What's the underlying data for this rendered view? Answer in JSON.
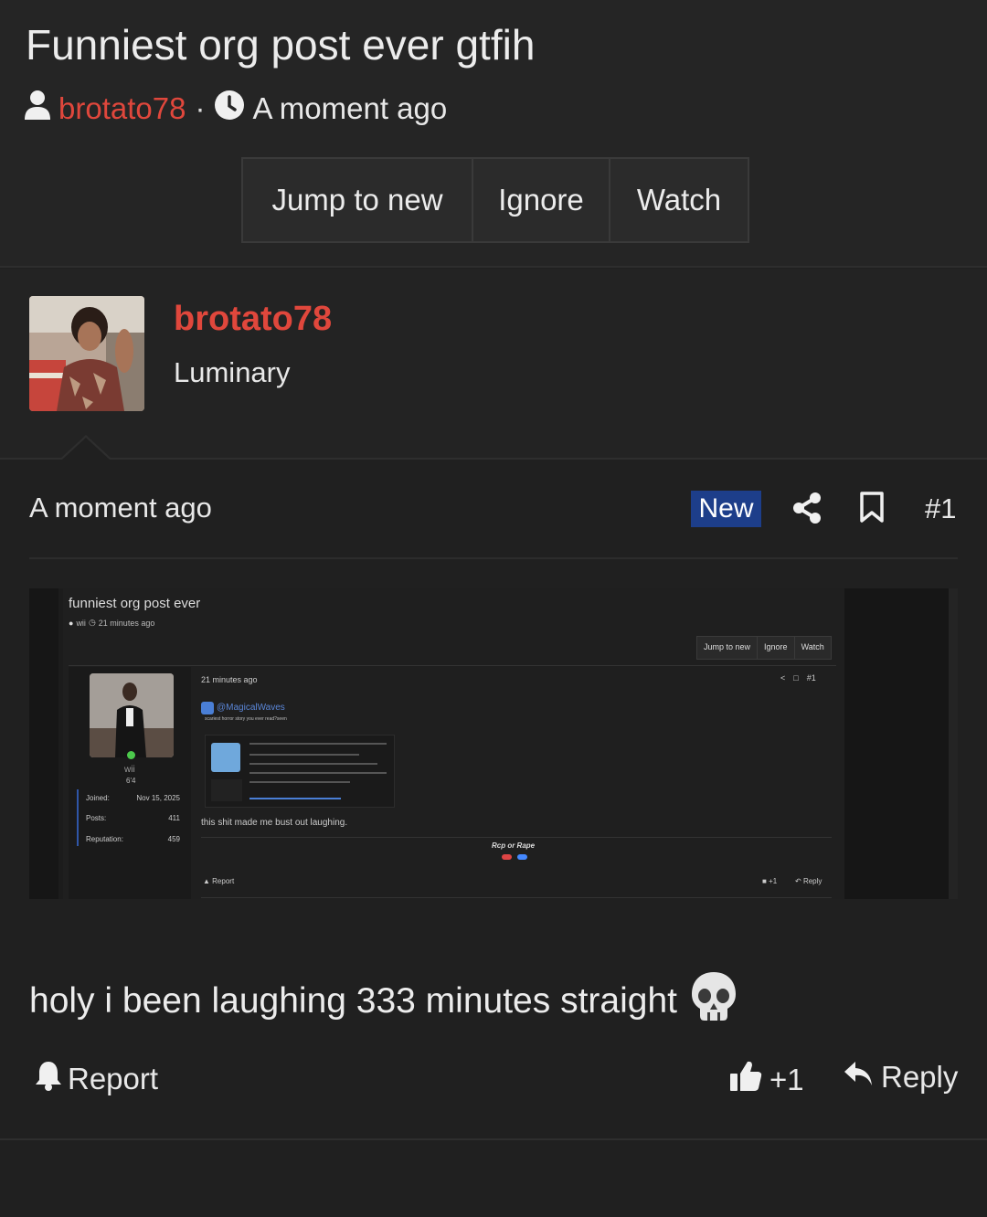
{
  "thread": {
    "title": "Funniest org post ever gtfih",
    "author": "brotato78",
    "separator": "·",
    "time": "A moment ago",
    "actions": {
      "jump": "Jump to new",
      "ignore": "Ignore",
      "watch": "Watch"
    }
  },
  "post": {
    "username": "brotato78",
    "rank": "Luminary",
    "time": "A moment ago",
    "badge": "New",
    "number": "#1",
    "body": "holy i been laughing 333 minutes straight",
    "emoji": "skull-icon",
    "report_label": "Report",
    "like_label": "+1",
    "reply_label": "Reply"
  },
  "embedded_screenshot": {
    "title": "funniest org post ever",
    "author": "wii",
    "time": "21 minutes ago",
    "actions": [
      "Jump to new",
      "Ignore",
      "Watch"
    ],
    "user": {
      "name": "wii",
      "height": "6'4"
    },
    "stats": [
      {
        "label": "Joined:",
        "value": "Nov 15, 2025"
      },
      {
        "label": "Posts:",
        "value": "411"
      },
      {
        "label": "Reputation:",
        "value": "459"
      }
    ],
    "post_time": "21 minutes ago",
    "post_number": "#1",
    "quote_user": "@MagicalWaves",
    "quote_line": "scariest horror story you ever read?seen",
    "caption": "this shit made me bust out laughing.",
    "signature": "Rcp or Rape",
    "report": "Report",
    "like": "+1",
    "reply": "Reply"
  },
  "colors": {
    "accent_red": "#e0473c",
    "badge_blue": "#1d3e8a",
    "bg": "#202020"
  }
}
